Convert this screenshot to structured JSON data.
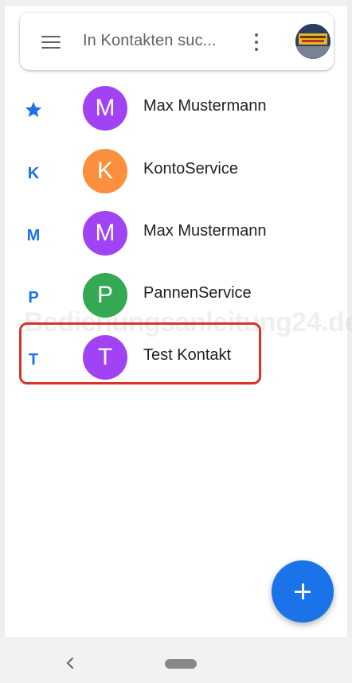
{
  "search": {
    "placeholder": "In Kontakten suc..."
  },
  "contacts": [
    {
      "index": "",
      "starred": true,
      "initial": "M",
      "name": "Max Mustermann",
      "avatar_color": "#a142f4"
    },
    {
      "index": "K",
      "starred": false,
      "initial": "K",
      "name": "KontoService",
      "avatar_color": "#fa903e"
    },
    {
      "index": "M",
      "starred": false,
      "initial": "M",
      "name": "Max Mustermann",
      "avatar_color": "#a142f4"
    },
    {
      "index": "P",
      "starred": false,
      "initial": "P",
      "name": "PannenService",
      "avatar_color": "#34a853"
    },
    {
      "index": "T",
      "starred": false,
      "initial": "T",
      "name": "Test Kontakt",
      "avatar_color": "#a142f4"
    }
  ],
  "watermark": "Bedienungsanleitung24.de",
  "colors": {
    "accent": "#1a73e8",
    "highlight": "#d9342b"
  },
  "icons": {
    "menu": "hamburger-menu-icon",
    "more": "vertical-dots-icon",
    "favorite": "star-icon",
    "add": "plus-icon",
    "back": "chevron-left-icon"
  }
}
